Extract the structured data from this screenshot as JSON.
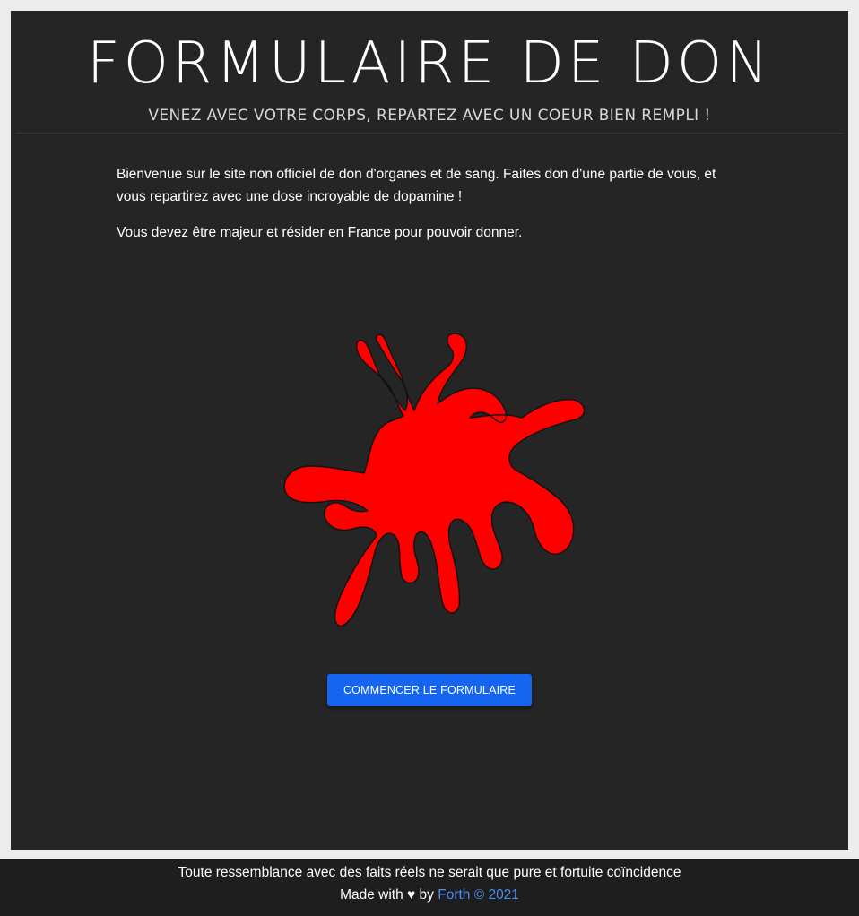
{
  "header": {
    "title": "FORMULAIRE DE DON",
    "subtitle": "VENEZ AVEC VOTRE CORPS, REPARTEZ AVEC UN COEUR BIEN REMPLI !"
  },
  "intro": {
    "paragraph_1": "Bienvenue sur le site non officiel de don d'organes et de sang. Faites don d'une partie de vous, et vous repartirez avec une dose incroyable de dopamine !",
    "paragraph_2": "Vous devez être majeur et résider en France pour pouvoir donner."
  },
  "illustration": {
    "icon": "blood-splat-icon",
    "color": "#ff0000"
  },
  "cta": {
    "label": "COMMENCER LE FORMULAIRE",
    "color": "#1565f0"
  },
  "footer": {
    "disclaimer": "Toute ressemblance avec des faits réels ne serait que pure et fortuite coïncidence",
    "made_with": "Made with",
    "heart": "♥",
    "by": "by",
    "link_text": "Forth © 2021",
    "link_color": "#4b8ef0"
  }
}
